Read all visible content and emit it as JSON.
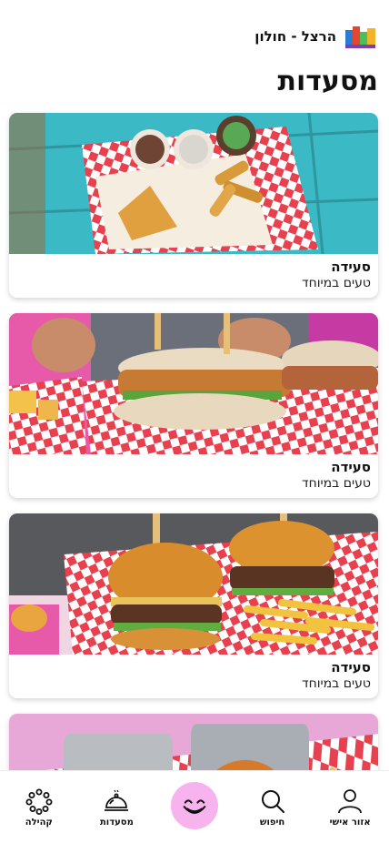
{
  "header": {
    "location": "הרצל - חולון",
    "logo_icon": "brand-logo-icon"
  },
  "page": {
    "title": "מסעדות"
  },
  "cards": [
    {
      "title": "סעידה",
      "subtitle": "טעים במיוחד",
      "image": "snack-tray-photo"
    },
    {
      "title": "סעידה",
      "subtitle": "טעים במיוחד",
      "image": "sandwich-photo"
    },
    {
      "title": "סעידה",
      "subtitle": "טעים במיוחד",
      "image": "burgers-photo"
    },
    {
      "title": "",
      "subtitle": "",
      "image": "tacos-fries-photo"
    }
  ],
  "nav": {
    "community": "קהילה",
    "restaurants": "מסעדות",
    "search": "חיפוש",
    "account": "אזור אישי",
    "center_icon": "smile-icon"
  },
  "colors": {
    "accent_pink": "#f7b3ee",
    "checker_red": "#e8404e",
    "table_teal": "#3bb9c4"
  }
}
